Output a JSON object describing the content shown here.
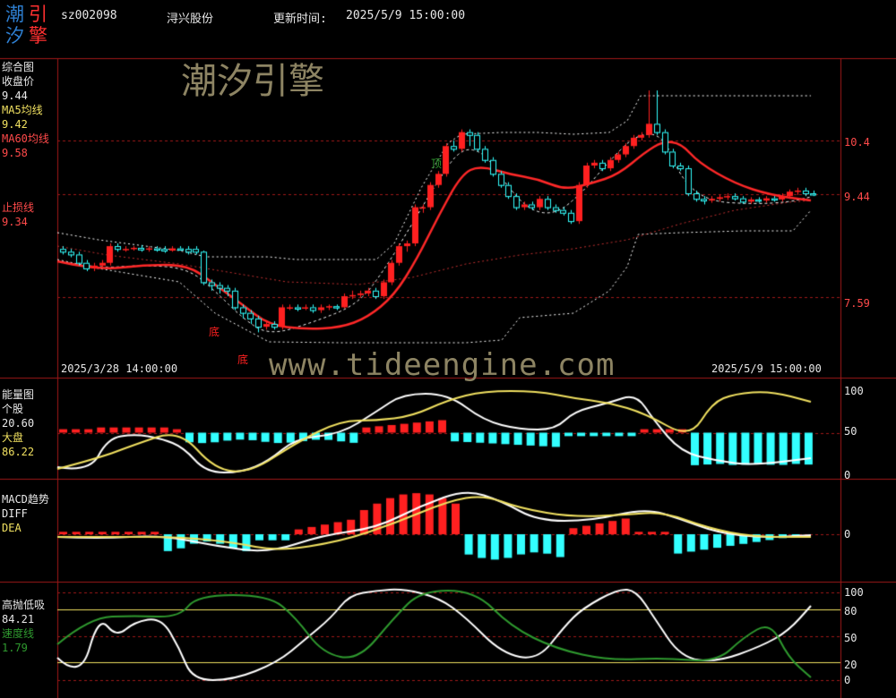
{
  "header": {
    "logo": [
      "潮",
      "引",
      "汐",
      "擎"
    ],
    "code": "sz002098",
    "name": "浔兴股份",
    "update_label": "更新时间:",
    "update_time": "2025/5/9 15:00:00"
  },
  "watermarks": {
    "cn": "潮汐引擎",
    "url": "www.tideengine.com"
  },
  "colors": {
    "up": "#ff2020",
    "down": "#33ffff",
    "grid": "#a01818",
    "ma5": "#f0e060",
    "ma60": "#ff2828",
    "white": "#ffffff",
    "green": "#2f9a2f"
  },
  "main_panel": {
    "labels": [
      {
        "text": "综合图",
        "color": "#e8e8e8"
      },
      {
        "text": "收盘价",
        "color": "#e8e8e8"
      },
      {
        "text": "9.44",
        "color": "#e8e8e8"
      },
      {
        "text": "MA5均线",
        "color": "#f0e060"
      },
      {
        "text": "9.42",
        "color": "#f0e060"
      },
      {
        "text": "MA60均线",
        "color": "#ff4a4a"
      },
      {
        "text": "9.58",
        "color": "#ff4a4a"
      },
      {
        "text": "止损线",
        "color": "#ff4a4a"
      },
      {
        "text": "9.34",
        "color": "#ff4a4a"
      }
    ],
    "y_ticks": [
      "10.4",
      "9.44",
      "7.59"
    ],
    "x_start": "2025/3/28 14:00:00",
    "x_end": "2025/5/9 15:00:00",
    "signals": {
      "bottom": "底",
      "top": "顶"
    }
  },
  "energy_panel": {
    "labels": [
      {
        "text": "能量图",
        "color": "#e8e8e8"
      },
      {
        "text": "个股",
        "color": "#e8e8e8"
      },
      {
        "text": "20.60",
        "color": "#e8e8e8"
      },
      {
        "text": "大盘",
        "color": "#f0e060"
      },
      {
        "text": "86.22",
        "color": "#f0e060"
      }
    ],
    "y_ticks": [
      "100",
      "50",
      "0"
    ]
  },
  "macd_panel": {
    "labels": [
      {
        "text": "MACD趋势",
        "color": "#e8e8e8"
      },
      {
        "text": "DIFF",
        "color": "#e8e8e8"
      },
      {
        "text": "DEA",
        "color": "#f0e060"
      }
    ],
    "y_ticks": [
      "0"
    ]
  },
  "timing_panel": {
    "labels": [
      {
        "text": "高抛低吸",
        "color": "#e8e8e8"
      },
      {
        "text": "84.21",
        "color": "#e8e8e8"
      },
      {
        "text": "速度线",
        "color": "#2f9a2f"
      },
      {
        "text": "1.79",
        "color": "#2f9a2f"
      }
    ],
    "y_ticks": [
      "100",
      "80",
      "50",
      "20",
      "0"
    ]
  },
  "chart_data": {
    "type": "candlestick",
    "price_ylim": [
      6.2,
      11.8
    ],
    "price_levels": [
      10.4,
      9.44,
      7.59
    ],
    "candles": [
      [
        8.45,
        8.4,
        8.5,
        8.35
      ],
      [
        8.4,
        8.35,
        8.45,
        8.3
      ],
      [
        8.35,
        8.2,
        8.4,
        8.15
      ],
      [
        8.2,
        8.1,
        8.25,
        8.05
      ],
      [
        8.1,
        8.15,
        8.2,
        8.05
      ],
      [
        8.15,
        8.2,
        8.25,
        8.1
      ],
      [
        8.2,
        8.5,
        8.55,
        8.15
      ],
      [
        8.5,
        8.45,
        8.55,
        8.4
      ],
      [
        8.45,
        8.45,
        8.5,
        8.4
      ],
      [
        8.45,
        8.47,
        8.5,
        8.42
      ],
      [
        8.47,
        8.44,
        8.52,
        8.4
      ],
      [
        8.44,
        8.46,
        8.5,
        8.4
      ],
      [
        8.46,
        8.45,
        8.5,
        8.4
      ],
      [
        8.45,
        8.42,
        8.5,
        8.38
      ],
      [
        8.42,
        8.46,
        8.5,
        8.4
      ],
      [
        8.46,
        8.45,
        8.5,
        8.42
      ],
      [
        8.45,
        8.4,
        8.5,
        8.35
      ],
      [
        8.45,
        8.4,
        8.5,
        8.35
      ],
      [
        8.4,
        7.85,
        8.42,
        7.8
      ],
      [
        7.85,
        7.8,
        7.9,
        7.7
      ],
      [
        7.8,
        7.75,
        7.85,
        7.65
      ],
      [
        7.75,
        7.7,
        7.8,
        7.6
      ],
      [
        7.7,
        7.4,
        7.75,
        7.35
      ],
      [
        7.4,
        7.3,
        7.45,
        7.2
      ],
      [
        7.3,
        7.2,
        7.35,
        7.1
      ],
      [
        7.2,
        7.05,
        7.25,
        6.95
      ],
      [
        7.05,
        7.1,
        7.15,
        7.0
      ],
      [
        7.1,
        7.05,
        7.15,
        7.0
      ],
      [
        7.05,
        7.4,
        7.45,
        7.0
      ],
      [
        7.4,
        7.4,
        7.45,
        7.35
      ],
      [
        7.4,
        7.38,
        7.45,
        7.33
      ],
      [
        7.38,
        7.4,
        7.45,
        7.35
      ],
      [
        7.4,
        7.35,
        7.45,
        7.3
      ],
      [
        7.35,
        7.4,
        7.45,
        7.3
      ],
      [
        7.4,
        7.42,
        7.45,
        7.35
      ],
      [
        7.42,
        7.4,
        7.45,
        7.35
      ],
      [
        7.4,
        7.6,
        7.65,
        7.38
      ],
      [
        7.6,
        7.62,
        7.7,
        7.55
      ],
      [
        7.62,
        7.65,
        7.7,
        7.58
      ],
      [
        7.65,
        7.7,
        7.75,
        7.6
      ],
      [
        7.7,
        7.6,
        7.75,
        7.55
      ],
      [
        7.6,
        7.85,
        7.9,
        7.55
      ],
      [
        7.85,
        8.2,
        8.25,
        7.8
      ],
      [
        8.2,
        8.5,
        8.55,
        8.15
      ],
      [
        8.5,
        8.55,
        8.6,
        8.4
      ],
      [
        8.55,
        9.2,
        9.25,
        8.5
      ],
      [
        9.2,
        9.2,
        9.25,
        9.1
      ],
      [
        9.2,
        9.6,
        9.65,
        9.15
      ],
      [
        9.6,
        9.8,
        9.85,
        9.55
      ],
      [
        9.8,
        10.3,
        10.35,
        9.75
      ],
      [
        10.3,
        10.25,
        10.4,
        10.2
      ],
      [
        10.25,
        10.55,
        10.6,
        10.2
      ],
      [
        10.55,
        10.5,
        10.6,
        10.3
      ],
      [
        10.5,
        10.25,
        10.55,
        10.2
      ],
      [
        10.25,
        10.05,
        10.3,
        10.0
      ],
      [
        10.05,
        9.8,
        10.1,
        9.75
      ],
      [
        9.8,
        9.6,
        9.85,
        9.55
      ],
      [
        9.6,
        9.4,
        9.65,
        9.35
      ],
      [
        9.4,
        9.2,
        9.45,
        9.15
      ],
      [
        9.2,
        9.25,
        9.3,
        9.15
      ],
      [
        9.25,
        9.2,
        9.3,
        9.15
      ],
      [
        9.2,
        9.35,
        9.4,
        9.15
      ],
      [
        9.35,
        9.2,
        9.4,
        9.15
      ],
      [
        9.2,
        9.15,
        9.25,
        9.1
      ],
      [
        9.15,
        9.1,
        9.2,
        9.05
      ],
      [
        9.1,
        8.95,
        9.15,
        8.9
      ],
      [
        8.95,
        9.6,
        9.65,
        8.9
      ],
      [
        9.6,
        9.95,
        10.0,
        9.55
      ],
      [
        9.95,
        10.0,
        10.05,
        9.9
      ],
      [
        10.0,
        9.9,
        10.05,
        9.85
      ],
      [
        9.9,
        10.05,
        10.1,
        9.85
      ],
      [
        10.05,
        10.15,
        10.2,
        10.0
      ],
      [
        10.15,
        10.3,
        10.35,
        10.1
      ],
      [
        10.3,
        10.45,
        10.5,
        10.25
      ],
      [
        10.45,
        10.5,
        10.55,
        10.4
      ],
      [
        10.5,
        10.7,
        11.3,
        10.45
      ],
      [
        10.7,
        10.55,
        11.3,
        10.5
      ],
      [
        10.55,
        10.2,
        10.6,
        10.15
      ],
      [
        10.2,
        9.95,
        10.25,
        9.9
      ],
      [
        9.95,
        9.9,
        10.0,
        9.85
      ],
      [
        9.9,
        9.45,
        9.95,
        9.4
      ],
      [
        9.45,
        9.35,
        9.5,
        9.3
      ],
      [
        9.35,
        9.32,
        9.4,
        9.25
      ],
      [
        9.32,
        9.35,
        9.4,
        9.28
      ],
      [
        9.35,
        9.38,
        9.42,
        9.3
      ],
      [
        9.38,
        9.4,
        9.45,
        9.33
      ],
      [
        9.4,
        9.36,
        9.45,
        9.32
      ],
      [
        9.36,
        9.3,
        9.4,
        9.26
      ],
      [
        9.3,
        9.34,
        9.38,
        9.26
      ],
      [
        9.34,
        9.32,
        9.38,
        9.28
      ],
      [
        9.32,
        9.36,
        9.4,
        9.28
      ],
      [
        9.36,
        9.34,
        9.4,
        9.3
      ],
      [
        9.34,
        9.4,
        9.45,
        9.3
      ],
      [
        9.4,
        9.48,
        9.52,
        9.35
      ],
      [
        9.48,
        9.5,
        9.55,
        9.42
      ],
      [
        9.5,
        9.45,
        9.55,
        9.4
      ],
      [
        9.45,
        9.44,
        9.5,
        9.4
      ]
    ]
  }
}
